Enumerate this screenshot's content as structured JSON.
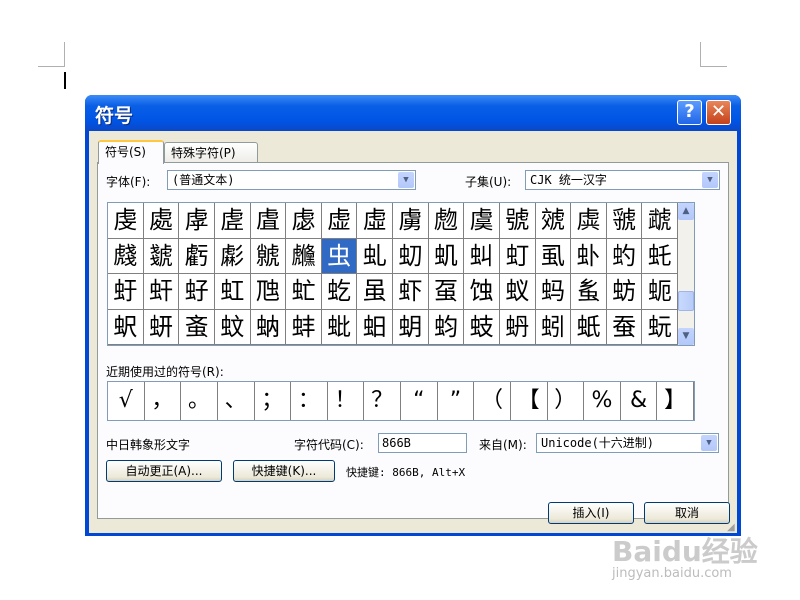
{
  "dialog": {
    "title": "符号",
    "help_label": "?",
    "close_label": "✕"
  },
  "tabs": [
    {
      "label": "符号(S)"
    },
    {
      "label": "特殊字符(P)"
    }
  ],
  "font": {
    "label": "字体(F):",
    "value": "(普通文本)"
  },
  "subset": {
    "label": "子集(U):",
    "value": "CJK 统一汉字"
  },
  "symbols": [
    [
      "虔",
      "處",
      "虖",
      "虗",
      "虘",
      "虙",
      "虚",
      "虛",
      "虜",
      "虝",
      "虞",
      "號",
      "虠",
      "虡",
      "虢",
      "虣",
      "虤"
    ],
    [
      "虥",
      "虦",
      "虧",
      "虨",
      "虩",
      "虪",
      "虫",
      "虬",
      "虭",
      "虮",
      "虯",
      "虰",
      "虱",
      "虲",
      "虳",
      "虴",
      "虵"
    ],
    [
      "虶",
      "虷",
      "虸",
      "虹",
      "虺",
      "虻",
      "虼",
      "虽",
      "虾",
      "虿",
      "蚀",
      "蚁",
      "蚂",
      "蚃",
      "蚄",
      "蚅",
      "蚆"
    ],
    [
      "蚇",
      "蚈",
      "蚉",
      "蚊",
      "蚋",
      "蚌",
      "蚍",
      "蚎",
      "蚏",
      "蚐",
      "蚑",
      "蚒",
      "蚓",
      "蚔",
      "蚕",
      "蚖",
      "蚗"
    ]
  ],
  "selected_symbol": "虫",
  "recent": {
    "label": "近期使用过的符号(R):",
    "items": [
      "√",
      "，",
      "。",
      "、",
      "；",
      "：",
      "！",
      "？",
      "“",
      "”",
      "（",
      "【",
      "）",
      "%",
      "&",
      "】",
      "※"
    ]
  },
  "char_name": "中日韩象形文字",
  "char_code": {
    "label": "字符代码(C):",
    "value": "866B"
  },
  "from": {
    "label": "来自(M):",
    "value": "Unicode(十六进制)"
  },
  "autocorrect_label": "自动更正(A)...",
  "shortcut_key_label": "快捷键(K)...",
  "shortcut_info": "快捷键: 866B, Alt+X",
  "insert_label": "插入(I)",
  "cancel_label": "取消",
  "watermark": {
    "brand": "Baidu经验",
    "url": "jingyan.baidu.com"
  }
}
